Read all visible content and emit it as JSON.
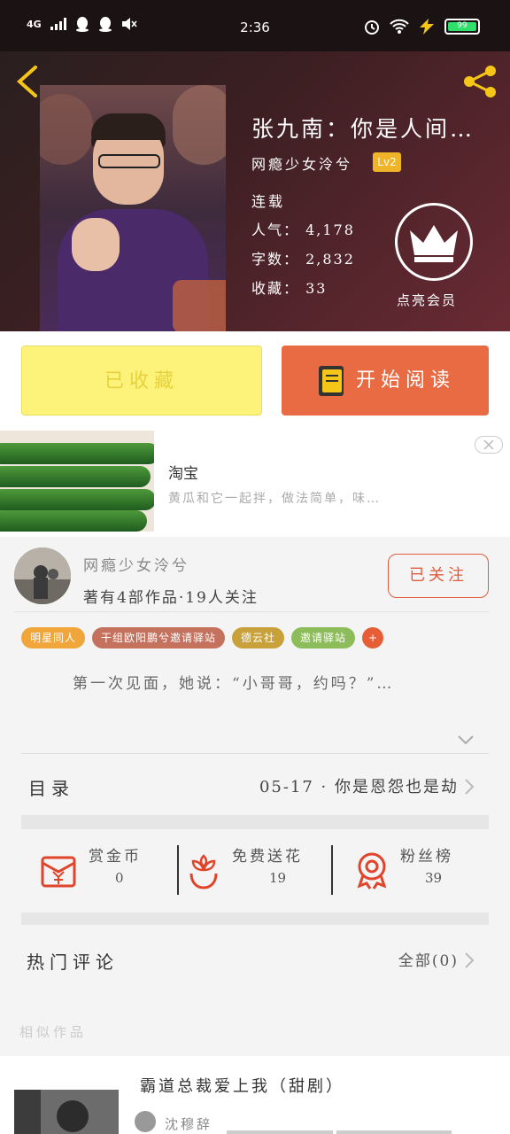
{
  "status_bar": {
    "network": "4G",
    "time": "2:36",
    "battery": "99",
    "battery_level": 0.99
  },
  "book": {
    "title": "张九南：你是人间…",
    "author": "网瘾少女泠兮",
    "author_level": "Lv2",
    "status": "连载",
    "popularity_label": "人气：",
    "popularity": "4,178",
    "word_count_label": "字数：",
    "word_count": "2,832",
    "favorites_label": "收藏：",
    "favorites": "33",
    "vip_label": "点亮会员"
  },
  "actions": {
    "collected_label": "已收藏",
    "read_label": "开始阅读"
  },
  "ad": {
    "title": "淘宝",
    "description": "黄瓜和它一起拌，做法简单，味…"
  },
  "author_card": {
    "name": "网瘾少女泠兮",
    "info": "著有4部作品·19人关注",
    "follow_label": "已关注",
    "tags": [
      {
        "label": "明星同人",
        "color": "#f0a63a"
      },
      {
        "label": "干组欧阳鹏兮邀请驿站",
        "color": "#c4715d"
      },
      {
        "label": "德云社",
        "color": "#c9a13a"
      },
      {
        "label": "邀请驿站",
        "color": "#8dbd5a"
      }
    ],
    "tag_more": "+",
    "intro": "第一次见面，她说：“小哥哥，约吗？”…"
  },
  "toc": {
    "label": "目录",
    "latest": "05-17 · 你是恩怨也是劫"
  },
  "gifts": {
    "reward_label": "赏金币",
    "reward_value": "0",
    "flower_label": "免费送花",
    "flower_value": "19",
    "fans_label": "粉丝榜",
    "fans_value": "39"
  },
  "comments": {
    "label": "热门评论",
    "all_label": "全部(0)"
  },
  "similar": {
    "label": "相似作品",
    "items": [
      {
        "title": "霸道总裁爱上我（甜剧）",
        "author": "沈穆辞"
      }
    ]
  },
  "colors": {
    "accent": "#e96b43",
    "collect_bg": "#fdf37a",
    "follow": "#e05c3c",
    "level_badge": "#f0b429"
  }
}
